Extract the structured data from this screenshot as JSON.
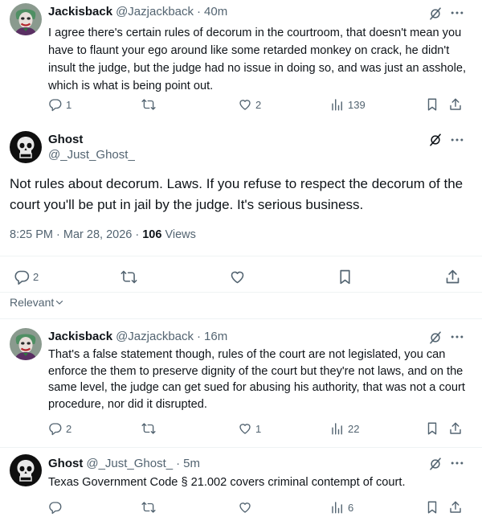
{
  "reply1": {
    "name": "Jackisback",
    "handle": "@Jazjackback",
    "dot": "·",
    "time": "40m",
    "text": "I agree there's certain rules of decorum in the courtroom, that doesn't mean you have to flaunt your ego around like some retarded monkey on crack, he didn't insult the judge, but the judge had no issue in doing so, and was just an asshole, which is what is being point out.",
    "replies": "1",
    "reposts": "",
    "likes": "2",
    "views": "139"
  },
  "main": {
    "name": "Ghost",
    "handle": "@_Just_Ghost_",
    "text": "Not rules about decorum. Laws. If you refuse to respect the decorum of the court you'll be put in jail by the judge. It's serious business.",
    "timestamp": "8:25 PM · Mar 28, 2026 · ",
    "views_count": "106",
    "views_label": " Views",
    "replies": "2"
  },
  "sort": {
    "label": "Relevant"
  },
  "reply2": {
    "name": "Jackisback",
    "handle": "@Jazjackback",
    "dot": "·",
    "time": "16m",
    "text": "That's a false statement though, rules of the court are not legislated, you can enforce the them to preserve dignity of the court but they're not laws, and on the same level, the judge can get sued for abusing his authority, that was not a court procedure, nor did it disrupted.",
    "replies": "2",
    "likes": "1",
    "views": "22"
  },
  "reply3": {
    "name": "Ghost",
    "handle": "@_Just_Ghost_",
    "dot": "·",
    "time": "5m",
    "text": "Texas Government Code § 21.002 covers criminal contempt of court.",
    "views": "6"
  },
  "colors": {
    "text": "#0f1419",
    "secondary": "#536471",
    "divider": "#eff3f4"
  },
  "icons": [
    "reply-icon",
    "repost-icon",
    "like-icon",
    "views-icon",
    "bookmark-icon",
    "share-icon",
    "grok-icon",
    "more-icon",
    "chevron-down-icon"
  ]
}
